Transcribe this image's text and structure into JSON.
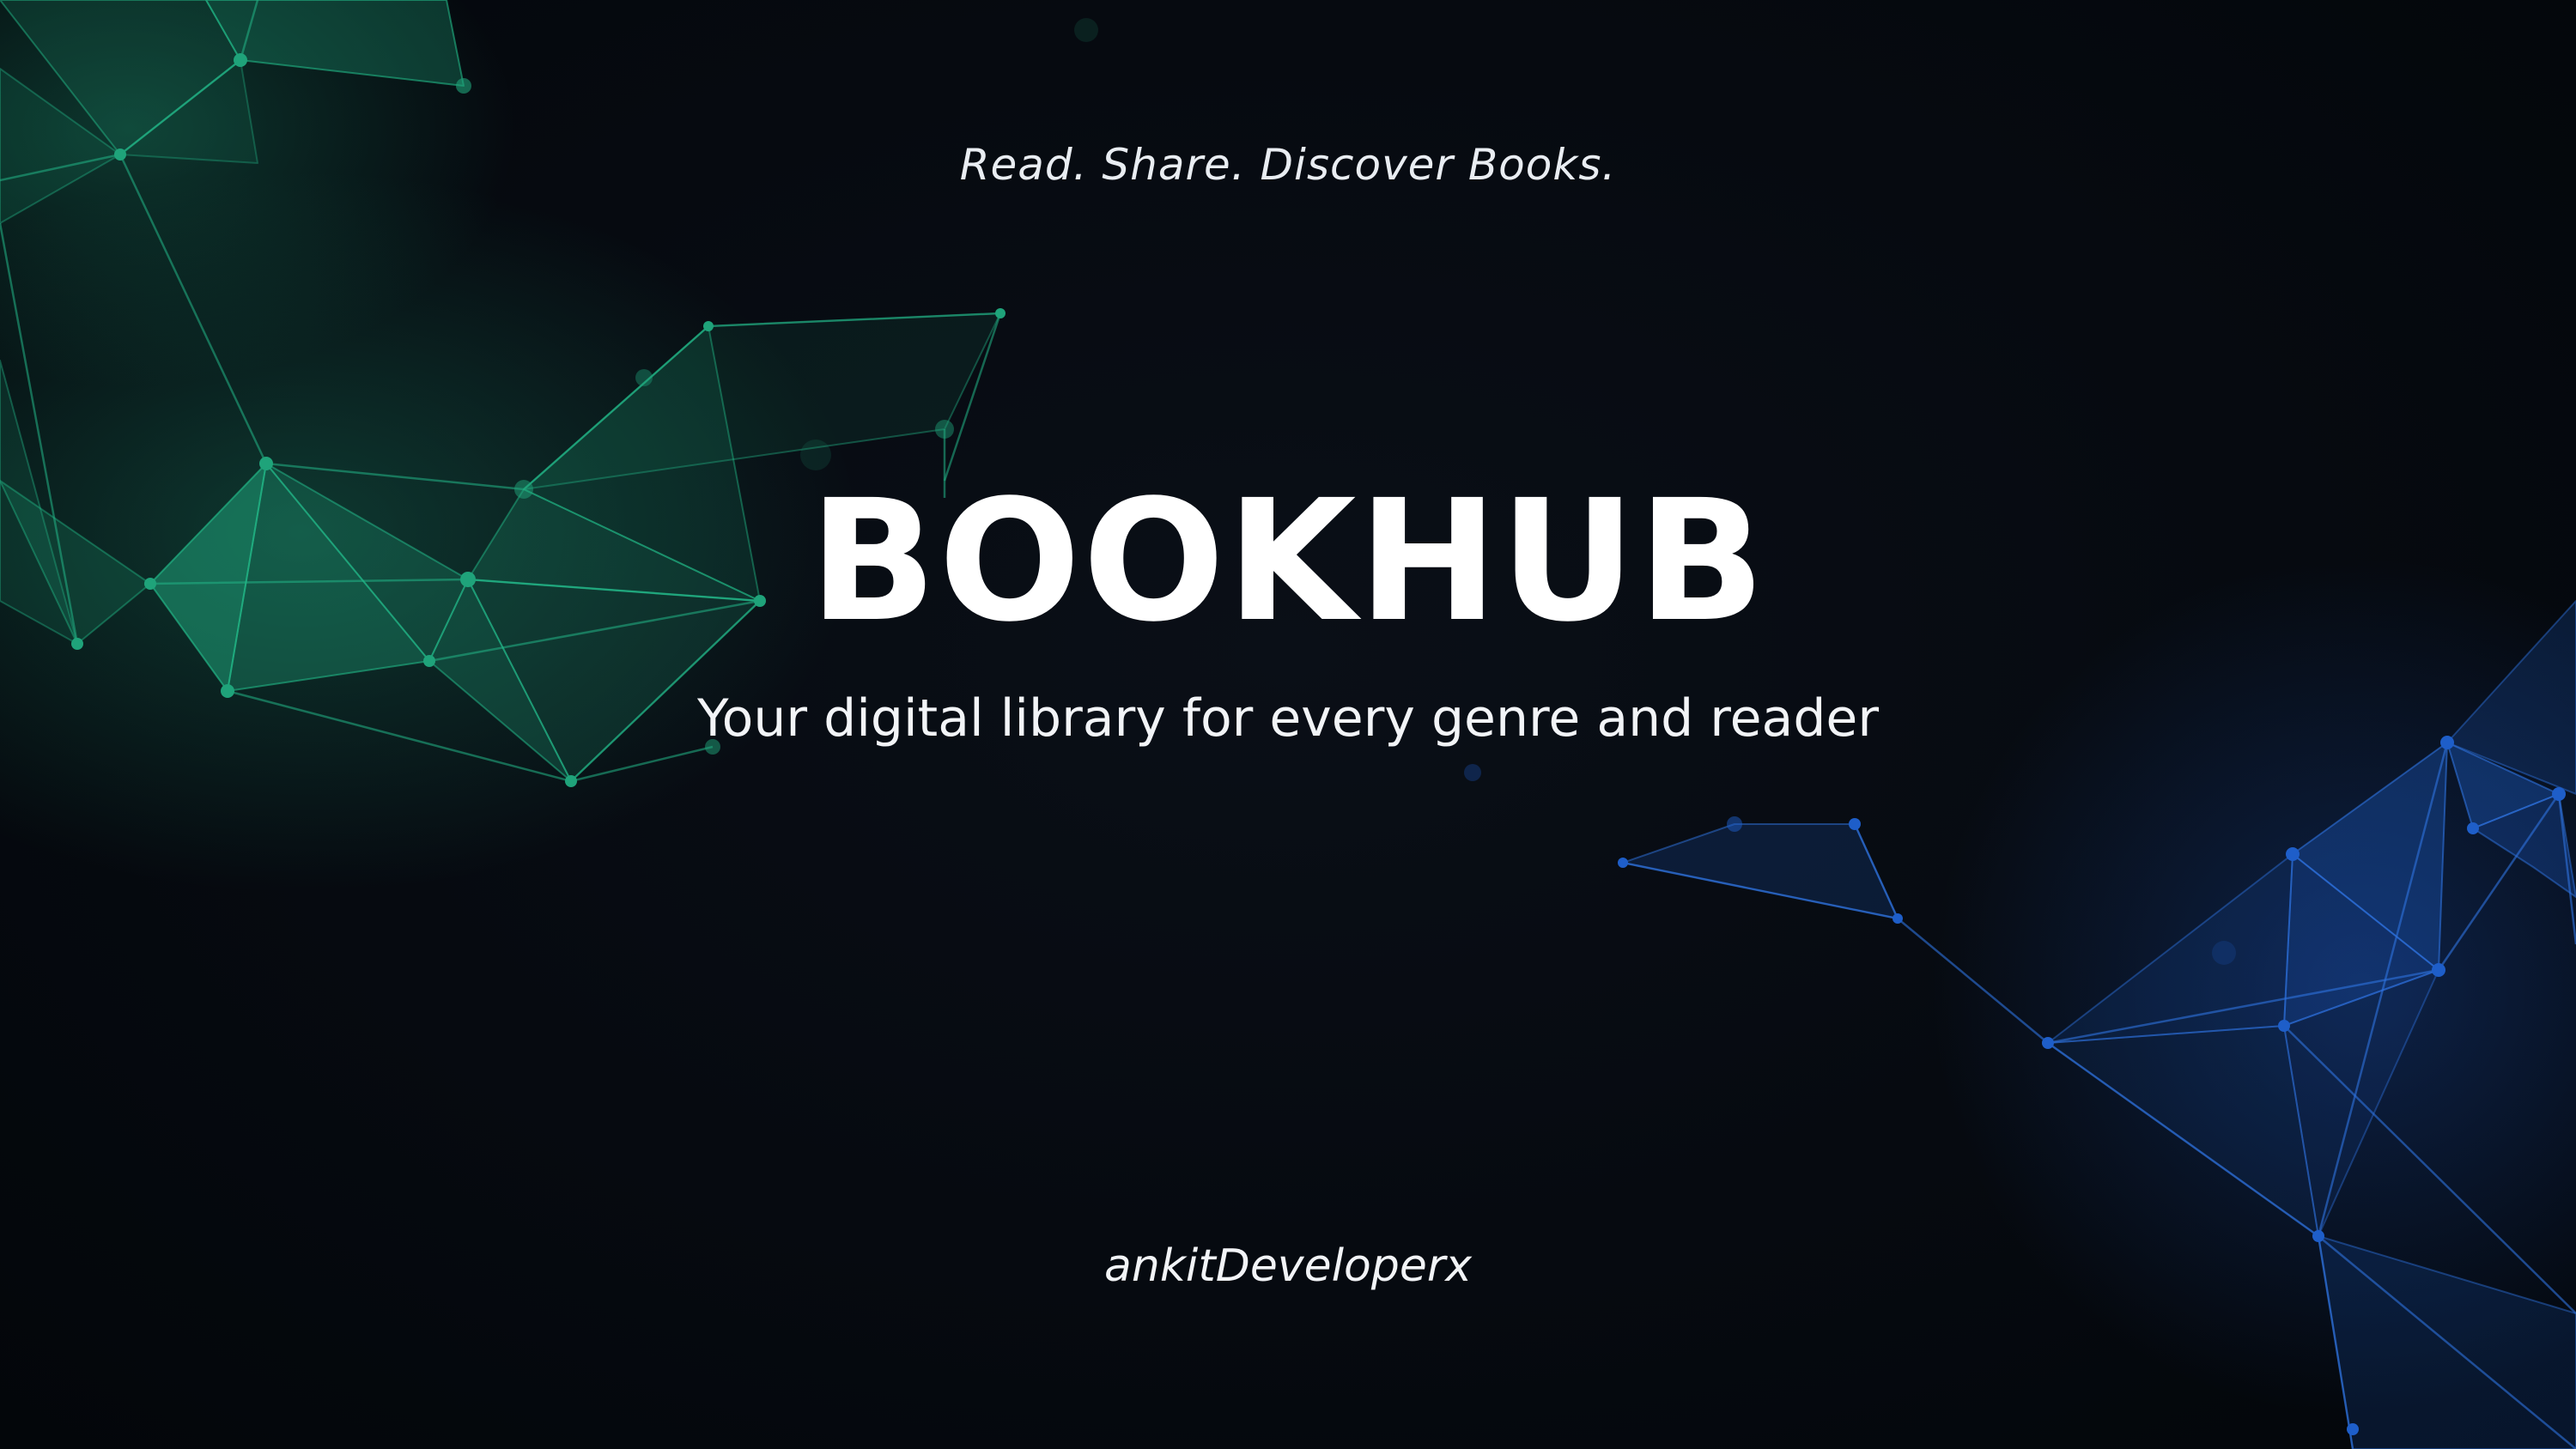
{
  "banner": {
    "tagline": "Read. Share. Discover Books.",
    "title": "BOOKHUB",
    "subtitle": "Your digital library for every genre and reader",
    "author": "ankitDeveloperx"
  },
  "colors": {
    "background": "#05080d",
    "network_left": "#1fa37a",
    "network_right": "#1e5ec9",
    "text": "#ffffff"
  }
}
